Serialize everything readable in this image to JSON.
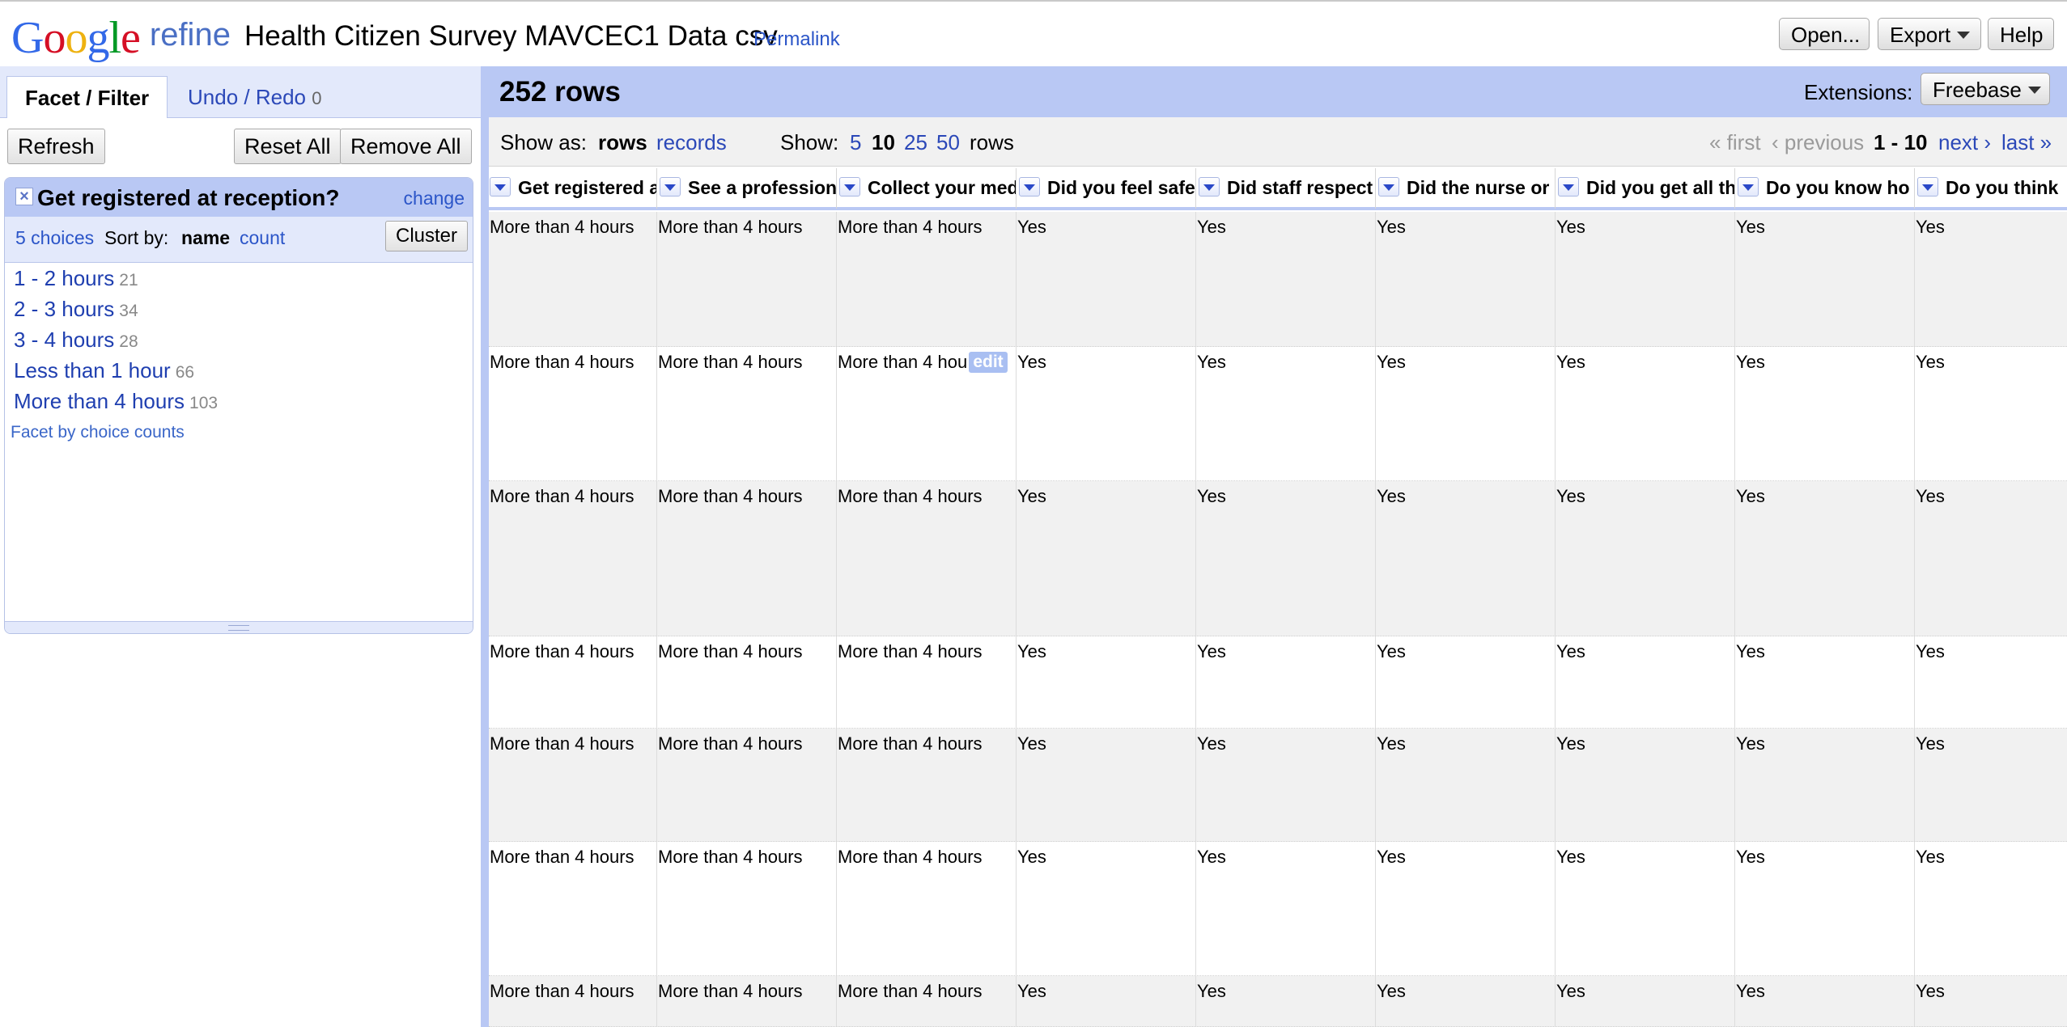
{
  "header": {
    "logo_google": "Google",
    "logo_refine": "refine",
    "project_title": "Health Citizen Survey MAVCEC1 Data csv",
    "permalink": "Permalink",
    "buttons": {
      "open": "Open...",
      "export": "Export",
      "help": "Help"
    }
  },
  "left_panel": {
    "tabs": {
      "facet_filter": "Facet / Filter",
      "undo_redo": "Undo / Redo",
      "undo_count": "0"
    },
    "buttons": {
      "refresh": "Refresh",
      "reset_all": "Reset All",
      "remove_all": "Remove All"
    },
    "facet": {
      "title": "Get registered at reception?",
      "change": "change",
      "choices_label": "5 choices",
      "sort_by": "Sort by:",
      "sort_name": "name",
      "sort_count": "count",
      "cluster": "Cluster",
      "items": [
        {
          "label": "1 - 2 hours",
          "count": "21"
        },
        {
          "label": "2 - 3 hours",
          "count": "34"
        },
        {
          "label": "3 - 4 hours",
          "count": "28"
        },
        {
          "label": "Less than 1 hour",
          "count": "66"
        },
        {
          "label": "More than 4 hours",
          "count": "103"
        }
      ],
      "facet_by_counts": "Facet by choice counts"
    }
  },
  "data_panel": {
    "rows_count": "252 rows",
    "extensions_label": "Extensions:",
    "extensions_button": "Freebase",
    "show_as_label": "Show as:",
    "show_as_rows": "rows",
    "show_as_records": "records",
    "show_label": "Show:",
    "page_sizes": [
      "5",
      "10",
      "25",
      "50"
    ],
    "page_size_selected": "10",
    "rows_suffix": "rows",
    "pager": {
      "first": "« first",
      "previous": "‹ previous",
      "range": "1 - 10",
      "next": "next ›",
      "last": "last »"
    },
    "columns": [
      "Get registered at reception?",
      "See a professional",
      "Collect your medicine",
      "Did you feel safe",
      "Did staff respect",
      "Did the nurse or",
      "Did you get all th",
      "Do you know ho",
      "Do you think"
    ],
    "rows": [
      [
        "More than 4 hours",
        "More than 4 hours",
        "More than 4 hours",
        "Yes",
        "Yes",
        "Yes",
        "Yes",
        "Yes",
        "Yes"
      ],
      [
        "More than 4 hours",
        "More than 4 hours",
        "More than 4 hou",
        "Yes",
        "Yes",
        "Yes",
        "Yes",
        "Yes",
        "Yes"
      ],
      [
        "More than 4 hours",
        "More than 4 hours",
        "More than 4 hours",
        "Yes",
        "Yes",
        "Yes",
        "Yes",
        "Yes",
        "Yes"
      ],
      [
        "More than 4 hours",
        "More than 4 hours",
        "More than 4 hours",
        "Yes",
        "Yes",
        "Yes",
        "Yes",
        "Yes",
        "Yes"
      ],
      [
        "More than 4 hours",
        "More than 4 hours",
        "More than 4 hours",
        "Yes",
        "Yes",
        "Yes",
        "Yes",
        "Yes",
        "Yes"
      ],
      [
        "More than 4 hours",
        "More than 4 hours",
        "More than 4 hours",
        "Yes",
        "Yes",
        "Yes",
        "Yes",
        "Yes",
        "Yes"
      ],
      [
        "More than 4 hours",
        "More than 4 hours",
        "More than 4 hours",
        "Yes",
        "Yes",
        "Yes",
        "Yes",
        "Yes",
        "Yes"
      ]
    ],
    "edit_label": "edit"
  },
  "colors": {
    "panel_blue": "#b9c8f4",
    "link_blue": "#2b48b8",
    "row_alt": "#f1f1f1"
  }
}
